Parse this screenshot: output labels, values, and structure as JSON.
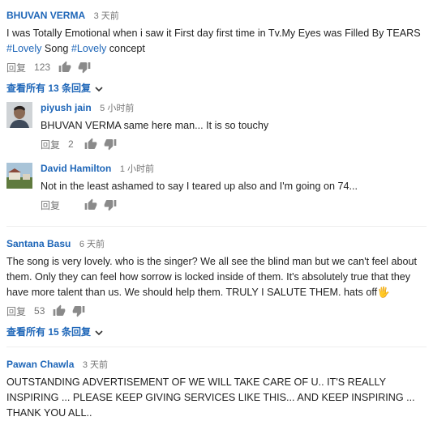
{
  "comments": [
    {
      "author": "BHUVAN VERMA",
      "time": "3 天前",
      "text_before": "I was Totally Emotional when i saw it First day first time in Tv.My Eyes was Filled By TEARS ",
      "hashtag1": "#Lovely",
      "text_mid": " Song ",
      "hashtag2": "#Lovely",
      "text_after": " concept",
      "reply_label": "回复",
      "likes": "123",
      "view_replies": "查看所有 13 条回复"
    },
    {
      "author": "Santana Basu",
      "time": "6 天前",
      "text": "The song is very lovely. who is the singer? We all see the blind man but we can't feel about them. Only they can feel how sorrow is locked inside of them. It's absolutely true that they have more talent than us. We should help them. TRULY I SALUTE THEM. hats off🖐",
      "reply_label": "回复",
      "likes": "53",
      "view_replies": "查看所有 15 条回复"
    },
    {
      "author": "Pawan Chawla",
      "time": "3 天前",
      "text": "OUTSTANDING ADVERTISEMENT OF WE WILL TAKE CARE OF U.. IT'S REALLY INSPIRING ... PLEASE KEEP GIVING SERVICES LIKE THIS... AND KEEP INSPIRING ... THANK YOU ALL.."
    }
  ],
  "replies": [
    {
      "author": "piyush jain",
      "time": "5 小时前",
      "text": "BHUVAN VERMA same here man... It is so touchy",
      "reply_label": "回复",
      "likes": "2"
    },
    {
      "author": "David Hamilton",
      "time": "1 小时前",
      "text": "Not in the least ashamed to say I teared up also and I'm going on 74...",
      "reply_label": "回复",
      "likes": ""
    }
  ],
  "icons": {
    "like": "thumbs-up-icon",
    "dislike": "thumbs-down-icon",
    "expand": "chevron-down-icon"
  },
  "colors": {
    "author": "#1e66b8",
    "link": "#1e66b8",
    "meta": "#767676",
    "icon": "#8a8a8a"
  }
}
